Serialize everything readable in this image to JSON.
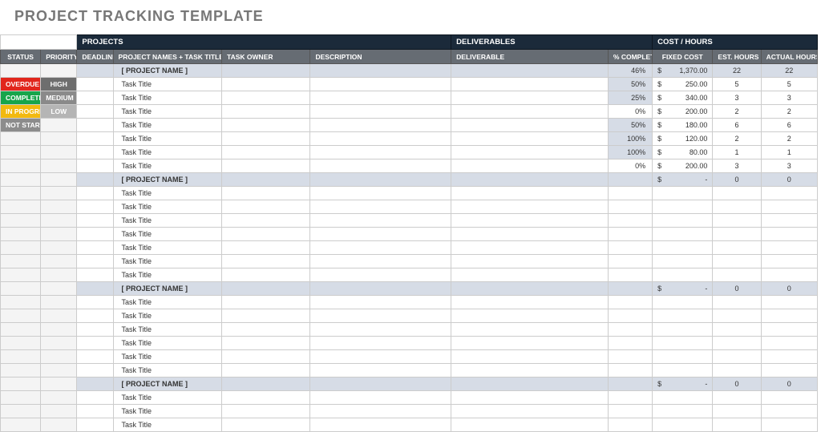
{
  "title": "PROJECT TRACKING TEMPLATE",
  "groups": {
    "projects": "PROJECTS",
    "deliverables": "DELIVERABLES",
    "cost": "COST / HOURS"
  },
  "headers": {
    "status": "STATUS",
    "priority": "PRIORITY",
    "deadline": "DEADLINE",
    "name": "PROJECT NAMES + TASK TITLES",
    "owner": "TASK OWNER",
    "desc": "DESCRIPTION",
    "deliverable": "DELIVERABLE",
    "pct": "% COMPLETE",
    "cost": "FIXED COST",
    "est": "EST. HOURS",
    "act": "ACTUAL HOURS"
  },
  "status_legend": [
    {
      "label": "OVERDUE",
      "class": "bg-overdue",
      "priority": "HIGH",
      "pclass": "bg-high"
    },
    {
      "label": "COMPLETED",
      "class": "bg-completed",
      "priority": "MEDIUM",
      "pclass": "bg-medium"
    },
    {
      "label": "IN PROGRESS",
      "class": "bg-inprogress",
      "priority": "LOW",
      "pclass": "bg-low"
    },
    {
      "label": "NOT STARTED",
      "class": "bg-notstarted",
      "priority": "",
      "pclass": ""
    }
  ],
  "chart_data": {
    "type": "table",
    "projects": [
      {
        "name": "[ PROJECT NAME ]",
        "pct": "46%",
        "cost": "1,370.00",
        "est": "22",
        "act": "22",
        "tasks": [
          {
            "name": "Task Title",
            "pct": "50%",
            "pct_shade": true,
            "cost": "250.00",
            "est": "5",
            "act": "5"
          },
          {
            "name": "Task Title",
            "pct": "25%",
            "pct_shade": true,
            "cost": "340.00",
            "est": "3",
            "act": "3"
          },
          {
            "name": "Task Title",
            "pct": "0%",
            "pct_shade": false,
            "cost": "200.00",
            "est": "2",
            "act": "2"
          },
          {
            "name": "Task Title",
            "pct": "50%",
            "pct_shade": true,
            "cost": "180.00",
            "est": "6",
            "act": "6"
          },
          {
            "name": "Task Title",
            "pct": "100%",
            "pct_shade": true,
            "cost": "120.00",
            "est": "2",
            "act": "2"
          },
          {
            "name": "Task Title",
            "pct": "100%",
            "pct_shade": true,
            "cost": "80.00",
            "est": "1",
            "act": "1"
          },
          {
            "name": "Task Title",
            "pct": "0%",
            "pct_shade": false,
            "cost": "200.00",
            "est": "3",
            "act": "3"
          }
        ]
      },
      {
        "name": "[ PROJECT NAME ]",
        "pct": "",
        "cost": "-",
        "est": "0",
        "act": "0",
        "tasks": [
          {
            "name": "Task Title"
          },
          {
            "name": "Task Title"
          },
          {
            "name": "Task Title"
          },
          {
            "name": "Task Title"
          },
          {
            "name": "Task Title"
          },
          {
            "name": "Task Title"
          },
          {
            "name": "Task Title"
          }
        ]
      },
      {
        "name": "[ PROJECT NAME ]",
        "pct": "",
        "cost": "-",
        "est": "0",
        "act": "0",
        "tasks": [
          {
            "name": "Task Title"
          },
          {
            "name": "Task Title"
          },
          {
            "name": "Task Title"
          },
          {
            "name": "Task Title"
          },
          {
            "name": "Task Title"
          },
          {
            "name": "Task Title"
          }
        ]
      },
      {
        "name": "[ PROJECT NAME ]",
        "pct": "",
        "cost": "-",
        "est": "0",
        "act": "0",
        "tasks": [
          {
            "name": "Task Title"
          },
          {
            "name": "Task Title"
          },
          {
            "name": "Task Title"
          }
        ]
      }
    ]
  }
}
